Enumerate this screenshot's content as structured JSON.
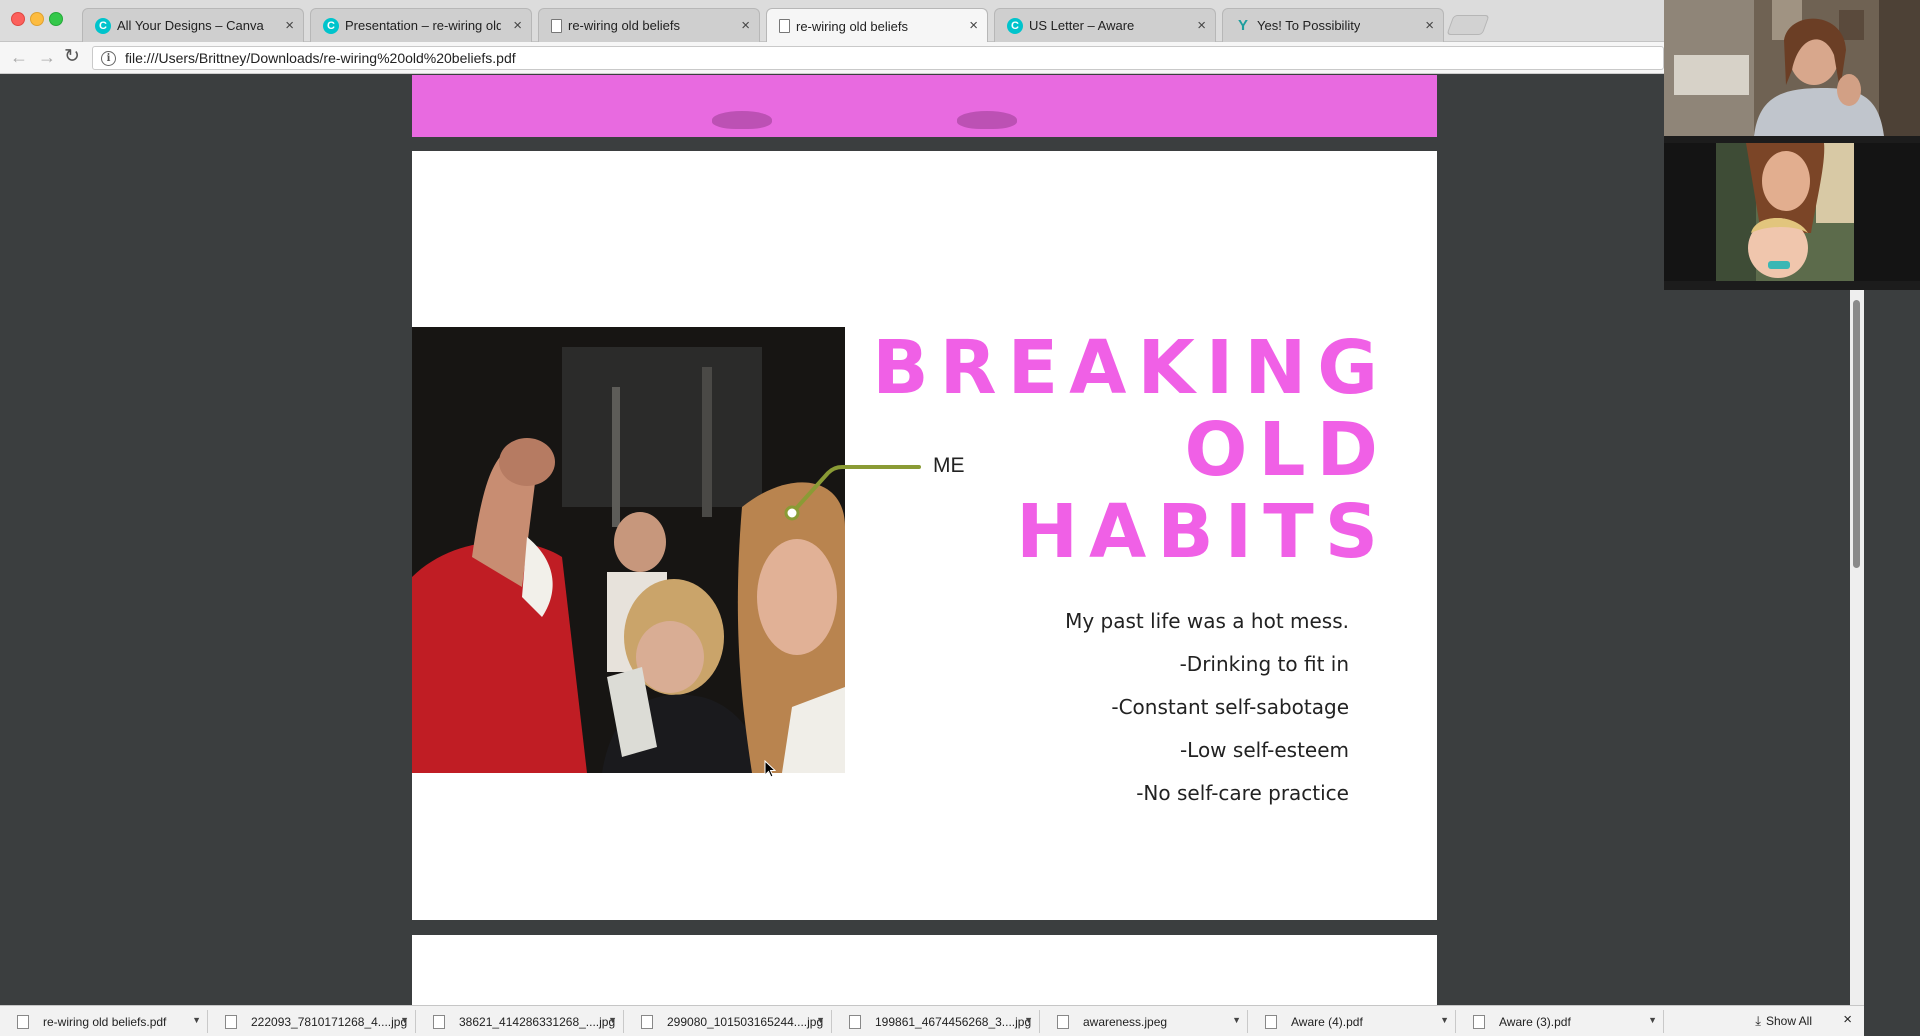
{
  "browser": {
    "tabs": [
      {
        "title": "All Your Designs – Canva",
        "favicon": "canva-icon",
        "active": false
      },
      {
        "title": "Presentation – re-wiring old be",
        "favicon": "canva-icon",
        "active": false
      },
      {
        "title": "re-wiring old beliefs",
        "favicon": "document-icon",
        "active": false
      },
      {
        "title": "re-wiring old beliefs",
        "favicon": "document-icon",
        "active": true
      },
      {
        "title": "US Letter – Aware",
        "favicon": "canva-icon",
        "active": false
      },
      {
        "title": "Yes! To Possibility",
        "favicon": "y-icon",
        "active": false
      }
    ],
    "close_glyph": "×",
    "address": "file:///Users/Brittney/Downloads/re-wiring%20old%20beliefs.pdf"
  },
  "slide": {
    "title_lines": [
      "BREAKING",
      "OLD",
      "HABITS"
    ],
    "photo_label": "ME",
    "body_lines": [
      "My past life was a hot mess.",
      "-Drinking to fit in",
      "-Constant self-sabotage",
      "-Low self-esteem",
      "-No self-care practice"
    ],
    "title_color": "#f060e6",
    "callout_color": "#8a9b35"
  },
  "downloads": {
    "items": [
      "re-wiring old beliefs.pdf",
      "222093_7810171268_4....jpg",
      "38621_414286331268_....jpg",
      "299080_101503165244....jpg",
      "199861_4674456268_3....jpg",
      "awareness.jpeg",
      "Aware (4).pdf",
      "Aware (3).pdf"
    ],
    "show_all": "Show All"
  }
}
